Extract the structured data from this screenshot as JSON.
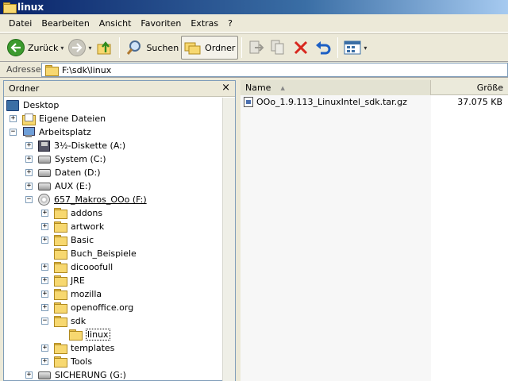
{
  "window": {
    "title": "linux"
  },
  "menu": [
    "Datei",
    "Bearbeiten",
    "Ansicht",
    "Favoriten",
    "Extras",
    "?"
  ],
  "toolbar": {
    "back_label": "Zurück",
    "search_label": "Suchen",
    "folders_label": "Ordner"
  },
  "address": {
    "label": "Adresse",
    "value": "F:\\sdk\\linux"
  },
  "left_pane": {
    "title": "Ordner",
    "close": "×",
    "tree": [
      {
        "label": "Desktop"
      },
      {
        "label": "Eigene Dateien"
      },
      {
        "label": "Arbeitsplatz"
      },
      {
        "label": "3½-Diskette (A:)"
      },
      {
        "label": "System (C:)"
      },
      {
        "label": "Daten (D:)"
      },
      {
        "label": "AUX (E:)"
      },
      {
        "label": "657_Makros_OOo (F:)"
      },
      {
        "label": "addons"
      },
      {
        "label": "artwork"
      },
      {
        "label": "Basic"
      },
      {
        "label": "Buch_Beispiele"
      },
      {
        "label": "dicooofull"
      },
      {
        "label": "JRE"
      },
      {
        "label": "mozilla"
      },
      {
        "label": "openoffice.org"
      },
      {
        "label": "sdk"
      },
      {
        "label": "linux"
      },
      {
        "label": "templates"
      },
      {
        "label": "Tools"
      },
      {
        "label": "SICHERUNG (G:)"
      }
    ]
  },
  "file_list": {
    "columns": {
      "name": "Name",
      "size": "Größe"
    },
    "files": [
      {
        "name": "OOo_1.9.113_LinuxIntel_sdk.tar.gz",
        "size": "37.075 KB"
      }
    ]
  },
  "colors": {
    "title_bar": "#0a246a",
    "window_bg": "#ece9d8",
    "folder_yellow": "#f7d870",
    "delete_red": "#d8281f",
    "undo_blue": "#1c5fc4"
  }
}
